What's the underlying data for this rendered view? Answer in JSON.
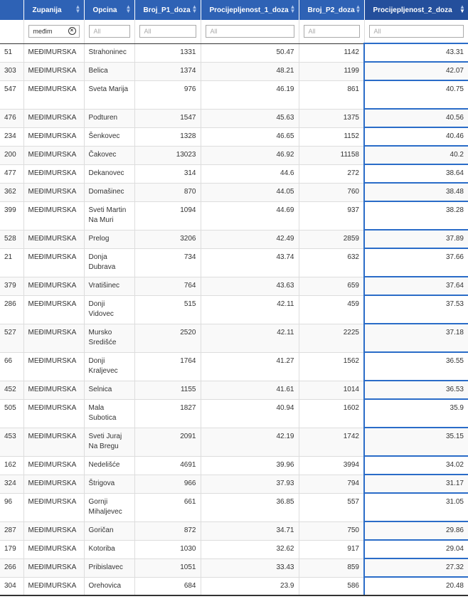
{
  "columns": [
    {
      "label": "",
      "filter": ""
    },
    {
      "label": "Zupanija",
      "filter": "međim"
    },
    {
      "label": "Opcina",
      "filter": "All"
    },
    {
      "label": "Broj_P1_doza",
      "filter": "All"
    },
    {
      "label": "Procijepljenost_1_doza",
      "filter": "All"
    },
    {
      "label": "Broj_P2_doza",
      "filter": "All"
    },
    {
      "label": "Procijepljenost_2_doza",
      "filter": "All"
    }
  ],
  "rows": [
    {
      "id": "51",
      "zupanija": "MEĐIMURSKA",
      "opcina": "Strahoninec",
      "p1": "1331",
      "proc1": "50.47",
      "p2": "1142",
      "proc2": "43.31",
      "tall": false
    },
    {
      "id": "303",
      "zupanija": "MEĐIMURSKA",
      "opcina": "Belica",
      "p1": "1374",
      "proc1": "48.21",
      "p2": "1199",
      "proc2": "42.07",
      "tall": false
    },
    {
      "id": "547",
      "zupanija": "MEĐIMURSKA",
      "opcina": "Sveta Marija",
      "p1": "976",
      "proc1": "46.19",
      "p2": "861",
      "proc2": "40.75",
      "tall": true
    },
    {
      "id": "476",
      "zupanija": "MEĐIMURSKA",
      "opcina": "Podturen",
      "p1": "1547",
      "proc1": "45.63",
      "p2": "1375",
      "proc2": "40.56",
      "tall": false
    },
    {
      "id": "234",
      "zupanija": "MEĐIMURSKA",
      "opcina": "Šenkovec",
      "p1": "1328",
      "proc1": "46.65",
      "p2": "1152",
      "proc2": "40.46",
      "tall": false
    },
    {
      "id": "200",
      "zupanija": "MEĐIMURSKA",
      "opcina": "Čakovec",
      "p1": "13023",
      "proc1": "46.92",
      "p2": "11158",
      "proc2": "40.2",
      "tall": false
    },
    {
      "id": "477",
      "zupanija": "MEĐIMURSKA",
      "opcina": "Dekanovec",
      "p1": "314",
      "proc1": "44.6",
      "p2": "272",
      "proc2": "38.64",
      "tall": false
    },
    {
      "id": "362",
      "zupanija": "MEĐIMURSKA",
      "opcina": "Domašinec",
      "p1": "870",
      "proc1": "44.05",
      "p2": "760",
      "proc2": "38.48",
      "tall": false
    },
    {
      "id": "399",
      "zupanija": "MEĐIMURSKA",
      "opcina": "Sveti Martin Na Muri",
      "p1": "1094",
      "proc1": "44.69",
      "p2": "937",
      "proc2": "38.28",
      "tall": true
    },
    {
      "id": "528",
      "zupanija": "MEĐIMURSKA",
      "opcina": "Prelog",
      "p1": "3206",
      "proc1": "42.49",
      "p2": "2859",
      "proc2": "37.89",
      "tall": false
    },
    {
      "id": "21",
      "zupanija": "MEĐIMURSKA",
      "opcina": "Donja Dubrava",
      "p1": "734",
      "proc1": "43.74",
      "p2": "632",
      "proc2": "37.66",
      "tall": true
    },
    {
      "id": "379",
      "zupanija": "MEĐIMURSKA",
      "opcina": "Vratišinec",
      "p1": "764",
      "proc1": "43.63",
      "p2": "659",
      "proc2": "37.64",
      "tall": false
    },
    {
      "id": "286",
      "zupanija": "MEĐIMURSKA",
      "opcina": "Donji Vidovec",
      "p1": "515",
      "proc1": "42.11",
      "p2": "459",
      "proc2": "37.53",
      "tall": true
    },
    {
      "id": "527",
      "zupanija": "MEĐIMURSKA",
      "opcina": "Mursko Središće",
      "p1": "2520",
      "proc1": "42.11",
      "p2": "2225",
      "proc2": "37.18",
      "tall": true
    },
    {
      "id": "66",
      "zupanija": "MEĐIMURSKA",
      "opcina": "Donji Kraljevec",
      "p1": "1764",
      "proc1": "41.27",
      "p2": "1562",
      "proc2": "36.55",
      "tall": true
    },
    {
      "id": "452",
      "zupanija": "MEĐIMURSKA",
      "opcina": "Selnica",
      "p1": "1155",
      "proc1": "41.61",
      "p2": "1014",
      "proc2": "36.53",
      "tall": false
    },
    {
      "id": "505",
      "zupanija": "MEĐIMURSKA",
      "opcina": "Mala Subotica",
      "p1": "1827",
      "proc1": "40.94",
      "p2": "1602",
      "proc2": "35.9",
      "tall": true
    },
    {
      "id": "453",
      "zupanija": "MEĐIMURSKA",
      "opcina": "Sveti Juraj Na Bregu",
      "p1": "2091",
      "proc1": "42.19",
      "p2": "1742",
      "proc2": "35.15",
      "tall": true
    },
    {
      "id": "162",
      "zupanija": "MEĐIMURSKA",
      "opcina": "Nedelišće",
      "p1": "4691",
      "proc1": "39.96",
      "p2": "3994",
      "proc2": "34.02",
      "tall": false
    },
    {
      "id": "324",
      "zupanija": "MEĐIMURSKA",
      "opcina": "Štrigova",
      "p1": "966",
      "proc1": "37.93",
      "p2": "794",
      "proc2": "31.17",
      "tall": false
    },
    {
      "id": "96",
      "zupanija": "MEĐIMURSKA",
      "opcina": "Gornji Mihaljevec",
      "p1": "661",
      "proc1": "36.85",
      "p2": "557",
      "proc2": "31.05",
      "tall": true
    },
    {
      "id": "287",
      "zupanija": "MEĐIMURSKA",
      "opcina": "Goričan",
      "p1": "872",
      "proc1": "34.71",
      "p2": "750",
      "proc2": "29.86",
      "tall": false
    },
    {
      "id": "179",
      "zupanija": "MEĐIMURSKA",
      "opcina": "Kotoriba",
      "p1": "1030",
      "proc1": "32.62",
      "p2": "917",
      "proc2": "29.04",
      "tall": false
    },
    {
      "id": "266",
      "zupanija": "MEĐIMURSKA",
      "opcina": "Pribislavec",
      "p1": "1051",
      "proc1": "33.43",
      "p2": "859",
      "proc2": "27.32",
      "tall": false
    },
    {
      "id": "304",
      "zupanija": "MEĐIMURSKA",
      "opcina": "Orehovica",
      "p1": "684",
      "proc1": "23.9",
      "p2": "586",
      "proc2": "20.48",
      "tall": false
    }
  ],
  "colors": {
    "header": "#2e62b5",
    "header_sorted": "#244f9c",
    "selection": "#2a6cc8"
  },
  "icons": {
    "sort": "sort-arrows-icon",
    "clear": "clear-circle-icon"
  }
}
